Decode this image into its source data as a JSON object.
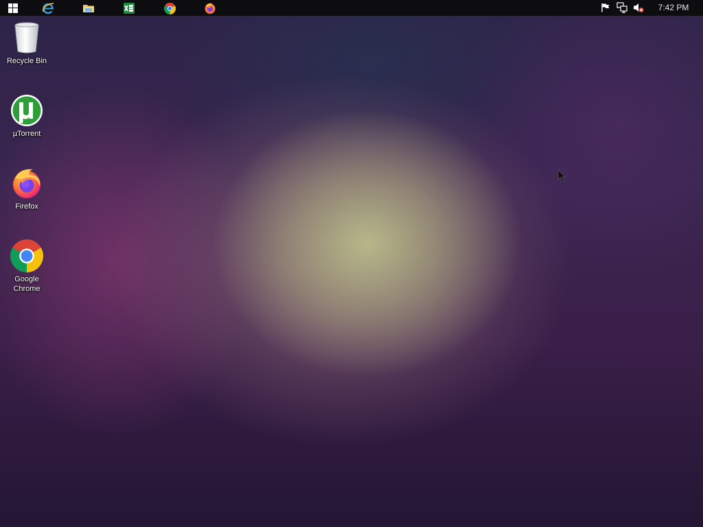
{
  "taskbar": {
    "pinned": [
      {
        "name": "windows-start",
        "icon": "windows-logo-icon"
      },
      {
        "name": "internet-explorer",
        "icon": "ie-icon"
      },
      {
        "name": "file-explorer",
        "icon": "folder-icon"
      },
      {
        "name": "excel",
        "icon": "excel-icon"
      },
      {
        "name": "chrome",
        "icon": "chrome-icon"
      },
      {
        "name": "firefox",
        "icon": "firefox-icon"
      }
    ],
    "tray": {
      "icons": [
        "flag-icon",
        "network-icon",
        "speaker-muted-icon"
      ],
      "clock": "7:42 PM"
    }
  },
  "desktop": {
    "icons": [
      {
        "label": "Recycle Bin",
        "icon": "recycle-bin-icon"
      },
      {
        "label": "µTorrent",
        "icon": "utorrent-icon"
      },
      {
        "label": "Firefox",
        "icon": "firefox-icon"
      },
      {
        "label": "Google\nChrome",
        "icon": "chrome-icon"
      }
    ]
  },
  "colors": {
    "taskbar_bg": "#0d0d0f",
    "utorrent_green": "#2e9e3a",
    "chrome_red": "#db4437",
    "chrome_yellow": "#f4c20d",
    "chrome_green": "#0f9d58",
    "chrome_blue": "#4285f4"
  }
}
